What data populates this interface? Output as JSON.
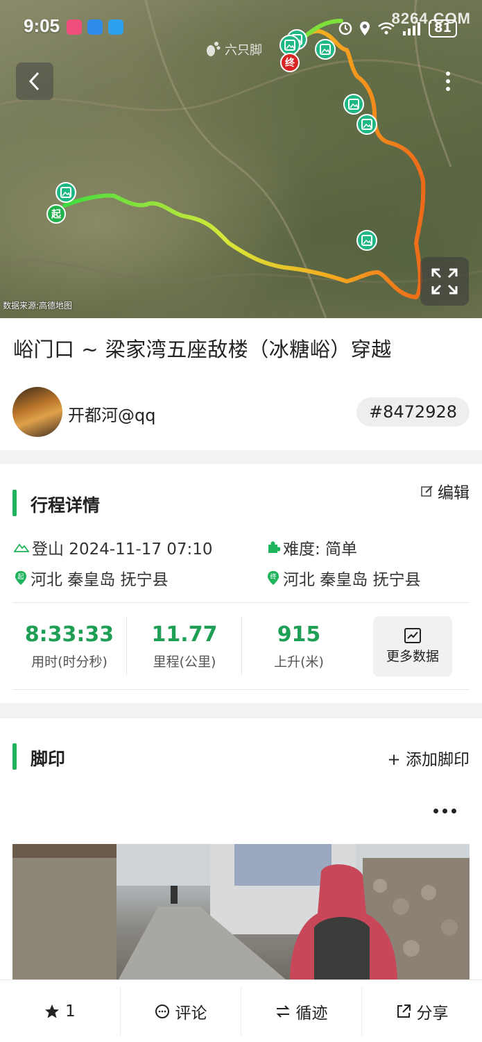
{
  "status_bar": {
    "time": "9:05",
    "battery": "81",
    "watermark": "8264.COM"
  },
  "map": {
    "brand": "六只脚",
    "source": "数据来源:高德地图",
    "start_marker": "起",
    "end_marker": "终"
  },
  "trip": {
    "title": "峪门口 ~ 梁家湾五座敌楼（冰糖峪）穿越",
    "username": "开都河@qq",
    "id": "#8472928"
  },
  "details": {
    "section_title": "行程详情",
    "edit_label": "编辑",
    "activity": "登山 2024-11-17 07:10",
    "difficulty": "难度:  简单",
    "start_location": "河北 秦皇岛 抚宁县",
    "end_location": "河北 秦皇岛 抚宁县",
    "stats": [
      {
        "value": "8:33:33",
        "label": "用时(时分秒)"
      },
      {
        "value": "11.77",
        "label": "里程(公里)"
      },
      {
        "value": "915",
        "label": "上升(米)"
      }
    ],
    "more_data_label": "更多数据"
  },
  "footprint": {
    "section_title": "脚印",
    "add_label": "+ 添加脚印"
  },
  "bottom_bar": {
    "star_count": "1",
    "comment": "评论",
    "follow_track": "循迹",
    "share": "分享"
  },
  "colors": {
    "accent": "#1fb35c",
    "stat_green": "#1f9e55",
    "start_marker": "#21b24c",
    "end_marker": "#d92424"
  }
}
